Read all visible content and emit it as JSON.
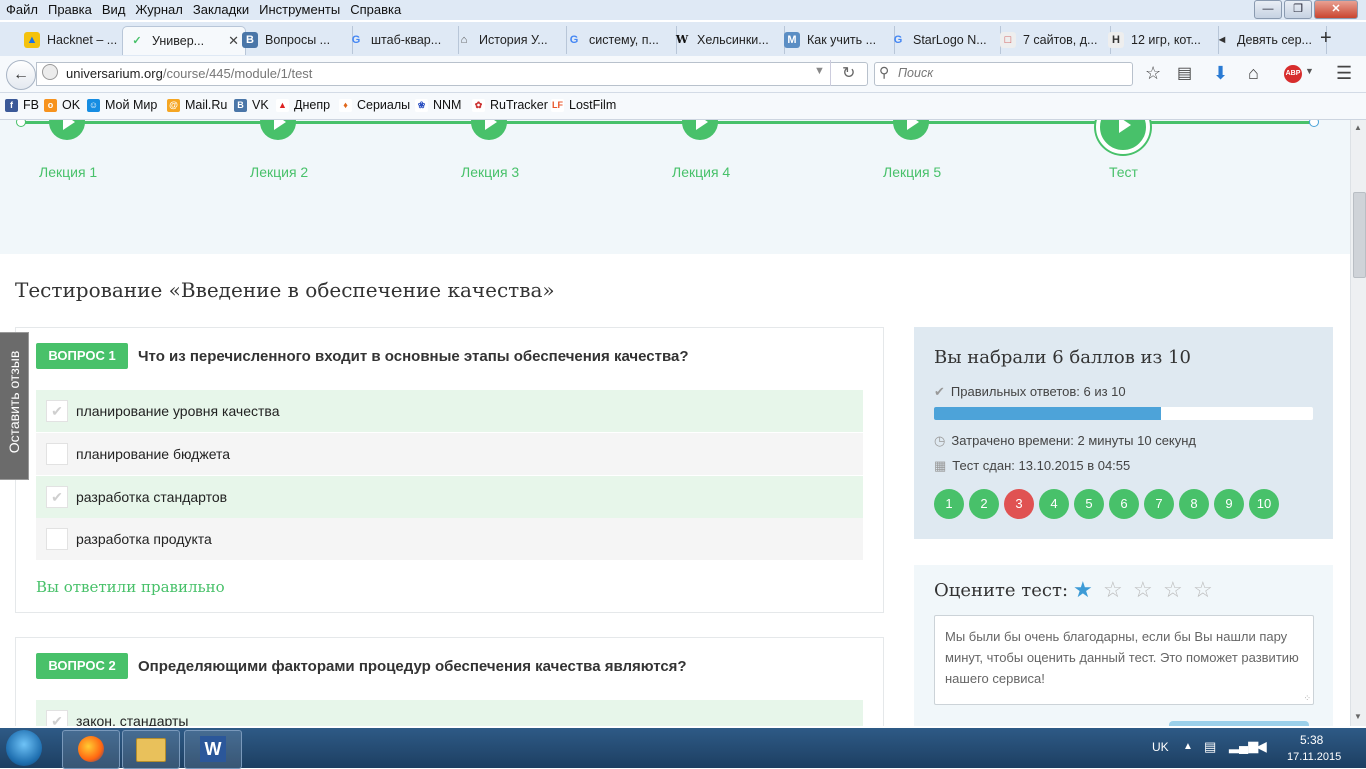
{
  "menubar": {
    "items": [
      "Файл",
      "Правка",
      "Вид",
      "Журнал",
      "Закладки",
      "Инструменты",
      "Справка"
    ]
  },
  "tabs": [
    {
      "label": "Hacknet – ...",
      "icon": "drive-icon"
    },
    {
      "label": "Универ...",
      "icon": "universarium-icon",
      "active": true
    },
    {
      "label": "Вопросы ...",
      "icon": "vk-icon"
    },
    {
      "label": "штаб-квар...",
      "icon": "google-icon"
    },
    {
      "label": "История У...",
      "icon": "building-icon"
    },
    {
      "label": "систему, п...",
      "icon": "google-icon"
    },
    {
      "label": "Хельсинки...",
      "icon": "wikipedia-icon"
    },
    {
      "label": "Как учить ...",
      "icon": "m-icon"
    },
    {
      "label": "StarLogo N...",
      "icon": "google-icon"
    },
    {
      "label": "7 сайтов, д...",
      "icon": "page-icon"
    },
    {
      "label": "12 игр, кот...",
      "icon": "h-icon"
    },
    {
      "label": "Девять сер...",
      "icon": "car-icon"
    }
  ],
  "address": {
    "host": "universarium.org",
    "path": "/course/445/module/1/test"
  },
  "search": {
    "placeholder": "Поиск"
  },
  "bookmarks": [
    "FB",
    "OK",
    "Мой Мир",
    "Mail.Ru",
    "VK",
    "Днепр",
    "Сериалы",
    "NNM",
    "RuTracker",
    "LostFilm"
  ],
  "lectures": [
    "Лекция 1",
    "Лекция 2",
    "Лекция 3",
    "Лекция 4",
    "Лекция 5",
    "Тест"
  ],
  "test_title": "Тестирование «Введение в обеспечение качества»",
  "feedback_tab": "Оставить отзыв",
  "questions": [
    {
      "badge": "ВОПРОС 1",
      "text": "Что из перечисленного входит в основные этапы обеспечения качества?",
      "answers": [
        {
          "text": "планирование уровня качества",
          "checked": true
        },
        {
          "text": "планирование бюджета",
          "checked": false
        },
        {
          "text": "разработка стандартов",
          "checked": true
        },
        {
          "text": "разработка продукта",
          "checked": false
        }
      ],
      "result": "Вы ответили правильно"
    },
    {
      "badge": "ВОПРОС 2",
      "text": "Определяющими факторами процедур обеспечения качества являются?",
      "answers": [
        {
          "text": "закон, стандарты",
          "checked": true
        }
      ]
    }
  ],
  "score": {
    "title": "Вы набрали 6 баллов из 10",
    "correct": "Правильных ответов: 6 из 10",
    "correct_fraction": 0.6,
    "time": "Затрачено времени: 2 минуты 10 секунд",
    "date": "Тест сдан: 13.10.2015 в 04:55",
    "question_numbers": [
      "1",
      "2",
      "3",
      "4",
      "5",
      "6",
      "7",
      "8",
      "9",
      "10"
    ],
    "wrong_questions": [
      "3"
    ]
  },
  "rating": {
    "title": "Оцените тест:",
    "stars_filled": 1,
    "stars_total": 5,
    "placeholder": "Мы были бы очень благодарны, если бы Вы нашли пару минут, чтобы оценить данный тест. Это поможет развитию нашего сервиса!"
  },
  "taskbar": {
    "lang": "UK",
    "time": "5:38",
    "date": "17.11.2015"
  },
  "colors": {
    "accent_green": "#48c16a",
    "accent_blue": "#4da3d9",
    "wrong_red": "#e05252"
  }
}
